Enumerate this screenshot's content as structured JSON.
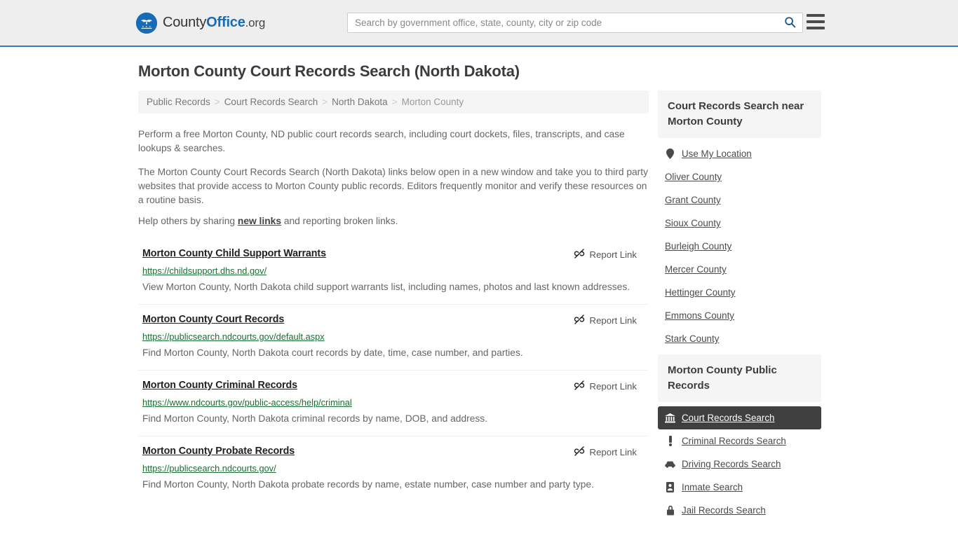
{
  "header": {
    "brand_county": "County",
    "brand_office": "Office",
    "brand_org": ".org",
    "search_placeholder": "Search by government office, state, county, city or zip code",
    "search_value": "",
    "search_icon": "search-icon",
    "menu_icon": "hamburger-menu-icon",
    "logo_icon": "countyoffice-eagle-logo"
  },
  "page": {
    "title": "Morton County Court Records Search (North Dakota)"
  },
  "breadcrumb": {
    "items": [
      {
        "label": "Public Records",
        "current": false
      },
      {
        "label": "Court Records Search",
        "current": false
      },
      {
        "label": "North Dakota",
        "current": false
      },
      {
        "label": "Morton County",
        "current": true
      }
    ],
    "separator": ">"
  },
  "intro": {
    "p1": "Perform a free Morton County, ND public court records search, including court dockets, files, transcripts, and case lookups & searches.",
    "p2": "The Morton County Court Records Search (North Dakota) links below open in a new window and take you to third party websites that provide access to Morton County public records. Editors frequently monitor and verify these resources on a routine basis.",
    "p3_before": "Help others by sharing ",
    "p3_link": "new links",
    "p3_after": " and reporting broken links."
  },
  "results": {
    "report_label": "Report Link",
    "report_icon": "broken-link-icon",
    "items": [
      {
        "title": "Morton County Child Support Warrants",
        "url": "https://childsupport.dhs.nd.gov/",
        "description": "View Morton County, North Dakota child support warrants list, including names, photos and last known addresses."
      },
      {
        "title": "Morton County Court Records",
        "url": "https://publicsearch.ndcourts.gov/default.aspx",
        "description": "Find Morton County, North Dakota court records by date, time, case number, and parties."
      },
      {
        "title": "Morton County Criminal Records",
        "url": "https://www.ndcourts.gov/public-access/help/criminal",
        "description": "Find Morton County, North Dakota criminal records by name, DOB, and address."
      },
      {
        "title": "Morton County Probate Records",
        "url": "https://publicsearch.ndcourts.gov/",
        "description": "Find Morton County, North Dakota probate records by name, estate number, case number and party type."
      }
    ]
  },
  "sidebar": {
    "nearby": {
      "heading": "Court Records Search near Morton County",
      "use_my_location": {
        "label": "Use My Location",
        "icon": "map-pin-icon"
      },
      "counties": [
        {
          "label": "Oliver County"
        },
        {
          "label": "Grant County"
        },
        {
          "label": "Sioux County"
        },
        {
          "label": "Burleigh County"
        },
        {
          "label": "Mercer County"
        },
        {
          "label": "Hettinger County"
        },
        {
          "label": "Emmons County"
        },
        {
          "label": "Stark County"
        }
      ]
    },
    "public_records": {
      "heading": "Morton County Public Records",
      "items": [
        {
          "label": "Court Records Search",
          "icon": "courthouse-icon",
          "active": true
        },
        {
          "label": "Criminal Records Search",
          "icon": "exclamation-icon",
          "active": false
        },
        {
          "label": "Driving Records Search",
          "icon": "car-icon",
          "active": false
        },
        {
          "label": "Inmate Search",
          "icon": "id-card-icon",
          "active": false
        },
        {
          "label": "Jail Records Search",
          "icon": "lock-icon",
          "active": false
        }
      ]
    }
  },
  "colors": {
    "brand_blue": "#1a6bb5",
    "header_border": "#337ab7",
    "header_bg": "#eeeeee",
    "url_green": "#1d6b35",
    "active_bg": "#3f3f3f",
    "panel_bg": "#f5f5f5"
  }
}
